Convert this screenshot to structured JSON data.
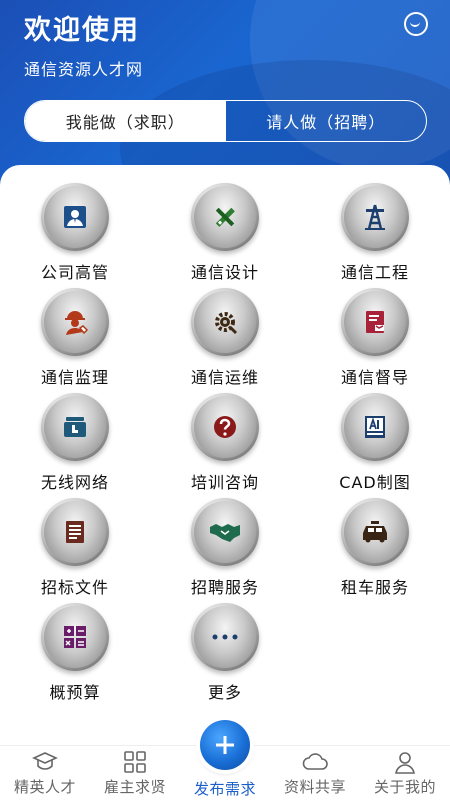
{
  "header": {
    "title": "欢迎使用",
    "subtitle": "通信资源人才网",
    "message_icon": "chat-smile-icon"
  },
  "tabs": [
    {
      "label": "我能做（求职）",
      "active": true
    },
    {
      "label": "请人做（招聘）",
      "active": false
    }
  ],
  "categories": [
    {
      "label": "公司高管",
      "icon": "executive-icon"
    },
    {
      "label": "通信设计",
      "icon": "design-tools-icon"
    },
    {
      "label": "通信工程",
      "icon": "tower-icon"
    },
    {
      "label": "通信监理",
      "icon": "supervisor-icon"
    },
    {
      "label": "通信运维",
      "icon": "maintenance-gear-icon"
    },
    {
      "label": "通信督导",
      "icon": "supervision-icon"
    },
    {
      "label": "无线网络",
      "icon": "wireless-network-icon"
    },
    {
      "label": "培训咨询",
      "icon": "question-icon"
    },
    {
      "label": "CAD制图",
      "icon": "cad-icon"
    },
    {
      "label": "招标文件",
      "icon": "document-icon"
    },
    {
      "label": "招聘服务",
      "icon": "handshake-icon"
    },
    {
      "label": "租车服务",
      "icon": "car-icon"
    },
    {
      "label": "概预算",
      "icon": "calculator-icon"
    },
    {
      "label": "更多",
      "icon": "more-dots-icon"
    }
  ],
  "bottom_nav": [
    {
      "label": "精英人才",
      "icon": "graduation-cap-icon",
      "active": false
    },
    {
      "label": "雇主求贤",
      "icon": "grid-icon",
      "active": false
    },
    {
      "label": "发布需求",
      "icon": "plus-icon",
      "active": true
    },
    {
      "label": "资料共享",
      "icon": "cloud-icon",
      "active": false
    },
    {
      "label": "关于我的",
      "icon": "person-icon",
      "active": false
    }
  ],
  "colors": {
    "header_blue": "#1a5ec9",
    "active_nav": "#1a5ec9"
  }
}
